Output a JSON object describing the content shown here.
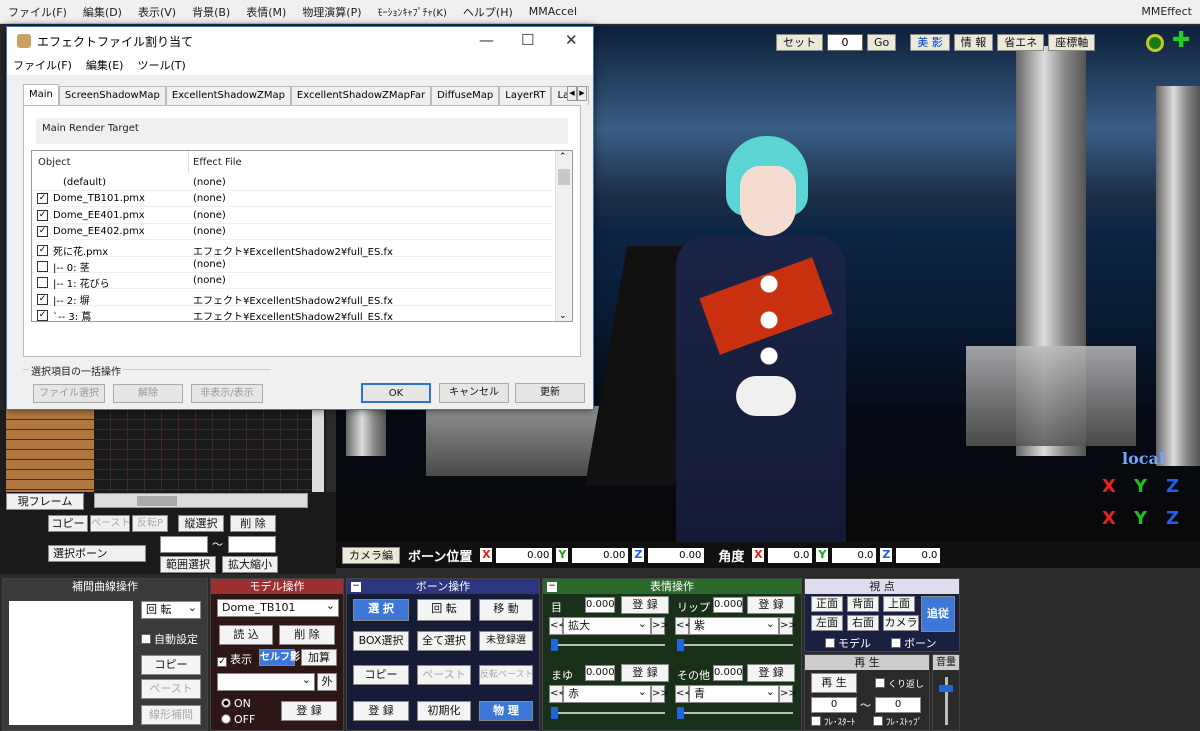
{
  "menubar": {
    "items": [
      "ファイル(F)",
      "編集(D)",
      "表示(V)",
      "背景(B)",
      "表情(M)",
      "物理演算(P)",
      "ﾓｰｼｮﾝｷｬﾌﾟﾁｬ(K)",
      "ヘルプ(H)",
      "MMAccel"
    ],
    "app_title": "MMEffect"
  },
  "viewport_toolbar": {
    "set_label": "セット",
    "frame_value": "0",
    "go_label": "Go",
    "bieffect_label": "美 影",
    "info_label": "情 報",
    "energy_label": "省エネ",
    "axis_label": "座標軸"
  },
  "viewport": {
    "local_label": "local",
    "axis_rot": [
      "X",
      "Y",
      "Z"
    ],
    "axis_move": [
      "X",
      "Y",
      "Z"
    ],
    "colors": {
      "x": "#e82020",
      "y": "#20c020",
      "z": "#2060e8"
    }
  },
  "bonebar": {
    "camera_label": "カメラ編",
    "pos_label": "ボーン位置",
    "angle_label": "角度",
    "pos": {
      "x": "0.00",
      "y": "0.00",
      "z": "0.00"
    },
    "angle": {
      "x": "0.0",
      "y": "0.0",
      "z": "0.0"
    }
  },
  "dialog": {
    "title": "エフェクトファイル割り当て",
    "menu": [
      "ファイル(F)",
      "編集(E)",
      "ツール(T)"
    ],
    "tabs": [
      "Main",
      "ScreenShadowMap",
      "ExcellentShadowZMap",
      "ExcellentShadowZMapFar",
      "DiffuseMap",
      "LayerRT",
      "Layer"
    ],
    "render_target": "Main Render Target",
    "col_object": "Object",
    "col_effect": "Effect File",
    "rows": [
      {
        "checked": null,
        "object": "(default)",
        "effect": "(none)"
      },
      {
        "checked": true,
        "object": "Dome_TB101.pmx",
        "effect": "(none)"
      },
      {
        "checked": true,
        "object": "Dome_EE401.pmx",
        "effect": "(none)"
      },
      {
        "checked": true,
        "object": "Dome_EE402.pmx",
        "effect": "(none)"
      },
      {
        "checked": true,
        "object": "死に花.pmx",
        "effect": "エフェクト¥ExcellentShadow2¥full_ES.fx"
      },
      {
        "checked": false,
        "object": "|-- 0: 茎",
        "effect": "(none)"
      },
      {
        "checked": false,
        "object": "|-- 1: 花びら",
        "effect": "(none)"
      },
      {
        "checked": true,
        "object": "|-- 2: 塀",
        "effect": "エフェクト¥ExcellentShadow2¥full_ES.fx"
      },
      {
        "checked": true,
        "object": "`-- 3: 蔦",
        "effect": "エフェクト¥ExcellentShadow2¥full_ES.fx"
      }
    ],
    "bulk_title": "選択項目の一括操作",
    "bulk_buttons": [
      "ファイル選択",
      "解除",
      "非表示/表示"
    ],
    "ok": "OK",
    "cancel": "キャンセル",
    "refresh": "更新"
  },
  "leftpanel": {
    "current_frame": "現フレーム",
    "copy": "コピー",
    "paste": "ペースト",
    "reverse_p": "反転P",
    "vertical_select": "縦選択",
    "delete": "削 除",
    "select_bone": "選択ボーン",
    "range_select": "範囲選択",
    "scale": "拡大縮小",
    "tilde": "～"
  },
  "interp_panel": {
    "title": "補間曲線操作",
    "rotate": "回 転",
    "auto_set": "自動設定",
    "copy": "コピー",
    "paste": "ペースト",
    "linear": "線形補間"
  },
  "model_panel": {
    "title": "モデル操作",
    "model": "Dome_TB101",
    "load": "読 込",
    "delete": "削 除",
    "display": "表示",
    "self_shadow": "セルフ影",
    "add": "加算",
    "outside": "外",
    "on": "ON",
    "off": "OFF",
    "register": "登 録"
  },
  "bone_panel": {
    "title": "ボーン操作",
    "select": "選 択",
    "rotate": "回 転",
    "move": "移 動",
    "box_select": "BOX選択",
    "select_all": "全て選択",
    "unregistered": "未登録選",
    "copy": "コピー",
    "paste": "ペースト",
    "reverse_paste": "反転ペースト",
    "register": "登 録",
    "init": "初期化",
    "physics": "物 理"
  },
  "face_panel": {
    "title": "表情操作",
    "eye_label": "目",
    "eye_value": "0.000",
    "eye_item": "拡大",
    "lip_label": "リップ",
    "lip_value": "0.000",
    "lip_item": "紫",
    "brow_label": "まゆ",
    "brow_value": "0.000",
    "brow_item": "赤",
    "other_label": "その他",
    "other_value": "0.000",
    "other_item": "青",
    "register": "登 録",
    "slider_value": 0
  },
  "view_panel": {
    "title": "視 点",
    "front": "正面",
    "back": "背面",
    "top": "上面",
    "follow": "追従",
    "left": "左面",
    "right": "右面",
    "camera": "カメラ",
    "model_chk": "モデル",
    "bone_chk": "ボーン"
  },
  "play_panel": {
    "title": "再 生",
    "play": "再 生",
    "repeat": "くり返し",
    "from": "0",
    "to": "0",
    "tilde": "～",
    "frame_start": "ﾌﾚ･ｽﾀｰﾄ",
    "frame_stop": "ﾌﾚ･ｽﾄｯﾌﾟ",
    "volume": "音量"
  }
}
